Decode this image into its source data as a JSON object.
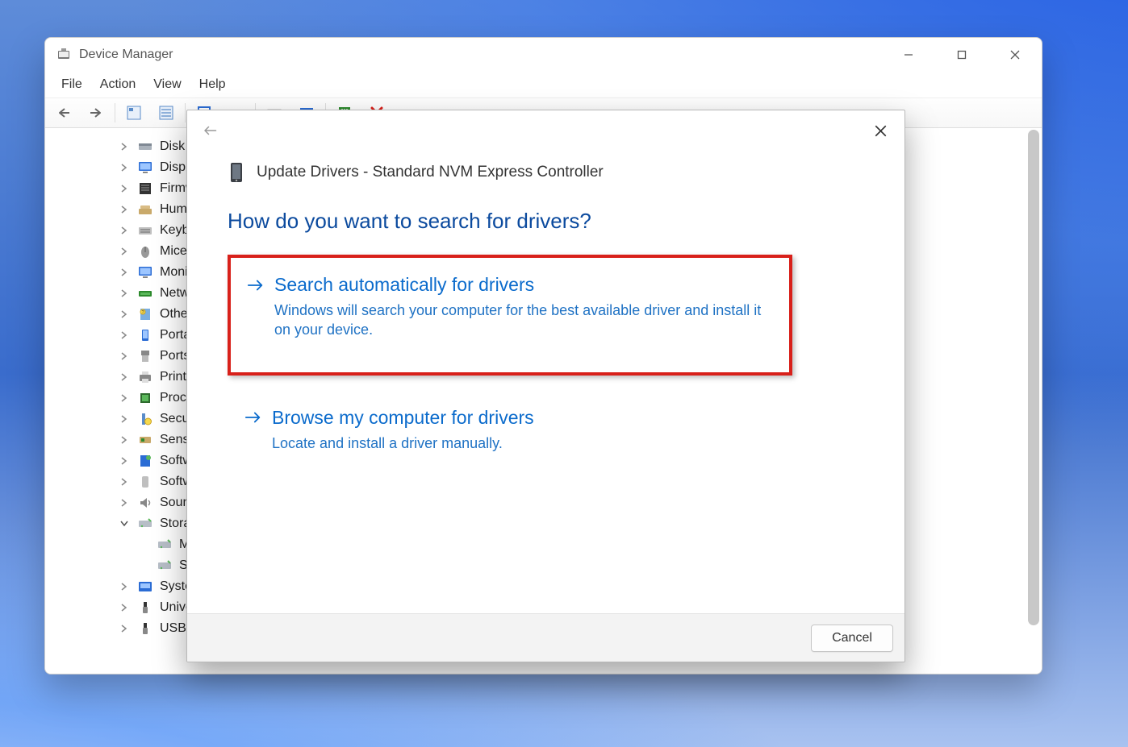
{
  "window": {
    "title": "Device Manager",
    "menu": {
      "file": "File",
      "action": "Action",
      "view": "View",
      "help": "Help"
    }
  },
  "tree": {
    "items": [
      {
        "label": "Disk drives",
        "icon": "disk",
        "expanded": false
      },
      {
        "label": "Display ad",
        "icon": "monitor",
        "expanded": false
      },
      {
        "label": "Firmware",
        "icon": "firmware",
        "expanded": false
      },
      {
        "label": "Human Inte",
        "icon": "hid",
        "expanded": false
      },
      {
        "label": "Keyboards",
        "icon": "keyboard",
        "expanded": false
      },
      {
        "label": "Mice and o",
        "icon": "mouse",
        "expanded": false
      },
      {
        "label": "Monitors",
        "icon": "monitor",
        "expanded": false
      },
      {
        "label": "Network ad",
        "icon": "network",
        "expanded": false
      },
      {
        "label": "Other devic",
        "icon": "other",
        "expanded": false
      },
      {
        "label": "Portable De",
        "icon": "portable",
        "expanded": false
      },
      {
        "label": "Ports (COM",
        "icon": "port",
        "expanded": false
      },
      {
        "label": "Print queue",
        "icon": "printer",
        "expanded": false
      },
      {
        "label": "Processors",
        "icon": "cpu",
        "expanded": false
      },
      {
        "label": "Security de",
        "icon": "security",
        "expanded": false
      },
      {
        "label": "Sensors",
        "icon": "sensor",
        "expanded": false
      },
      {
        "label": "Software co",
        "icon": "software",
        "expanded": false
      },
      {
        "label": "Software de",
        "icon": "device",
        "expanded": false
      },
      {
        "label": "Sound, vide",
        "icon": "audio",
        "expanded": false
      },
      {
        "label": "Storage con",
        "icon": "storage",
        "expanded": true,
        "children": [
          {
            "label": "Microso",
            "icon": "storage"
          },
          {
            "label": "Standar",
            "icon": "storage"
          }
        ]
      },
      {
        "label": "System dev",
        "icon": "system",
        "expanded": false
      },
      {
        "label": "Universal S",
        "icon": "usb",
        "expanded": false
      },
      {
        "label": "USB Conne",
        "icon": "usb",
        "expanded": false
      }
    ]
  },
  "dialog": {
    "title": "Update Drivers - Standard NVM Express Controller",
    "question": "How do you want to search for drivers?",
    "cancel": "Cancel",
    "options": [
      {
        "title": "Search automatically for drivers",
        "desc": "Windows will search your computer for the best available driver and install it on your device.",
        "highlighted": true
      },
      {
        "title": "Browse my computer for drivers",
        "desc": "Locate and install a driver manually.",
        "highlighted": false
      }
    ]
  }
}
